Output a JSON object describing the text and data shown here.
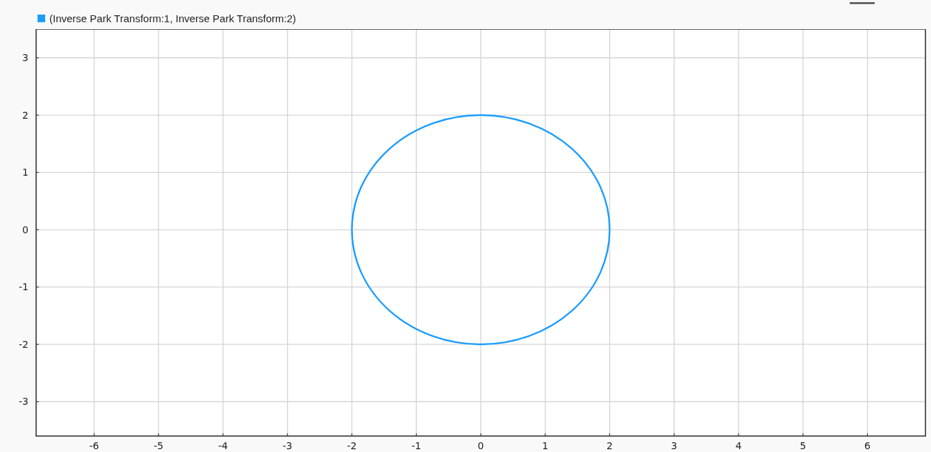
{
  "legend": [
    {
      "label": "(Inverse Park Transform:1, Inverse Park Transform:2)",
      "color": "#1a9cff"
    }
  ],
  "chart_data": {
    "type": "line",
    "xlim": [
      -6.9,
      6.9
    ],
    "ylim": [
      -3.6,
      3.5
    ],
    "xticks": [
      -6,
      -5,
      -4,
      -3,
      -2,
      -1,
      0,
      1,
      2,
      3,
      4,
      5,
      6
    ],
    "yticks": [
      -3,
      -2,
      -1,
      0,
      1,
      2,
      3
    ],
    "grid": true
  }
}
